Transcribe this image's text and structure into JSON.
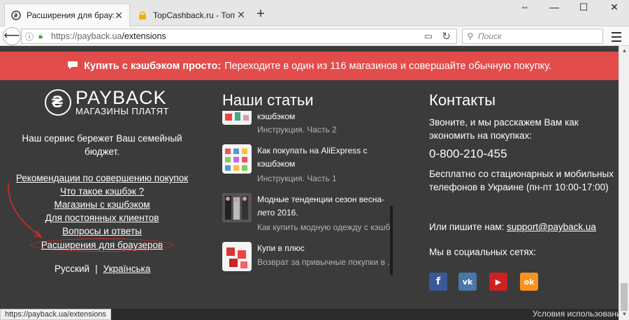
{
  "browser": {
    "tabs": [
      {
        "title": "Расширения для браузер",
        "favicon": "payback-favicon",
        "active": true
      },
      {
        "title": "TopCashback.ru - Топ лу",
        "favicon": "lock-favicon",
        "active": false
      }
    ],
    "new_tab": "+",
    "window": {
      "resize": "⇔",
      "minimize": "—",
      "maximize": "☐",
      "close": "✕"
    },
    "url_host": "https://payback.ua",
    "url_path": "/extensions",
    "search_placeholder": "Поиск",
    "status_url": "https://payback.ua/extensions"
  },
  "promo": {
    "bold": "Купить с кэшбэком просто:",
    "text": "Переходите в один из 116 магазинов и совершайте обычную покупку."
  },
  "col1": {
    "brand": "PAYBACK",
    "slogan": "МАГАЗИНЫ ПЛАТЯТ",
    "tagline": "Наш сервис бережет Ваш семейный бюджет.",
    "links": [
      "Рекомендации по совершению покупок",
      "Что такое кэшбэк ?",
      "Магазины с кэшбэком",
      "Для постоянных клиентов",
      "Вопросы и ответы",
      "Расширения для браузеров"
    ],
    "lang_ru": "Русский",
    "lang_sep": "|",
    "lang_uk": "Українська"
  },
  "col2": {
    "title": "Наши статьи",
    "articles": [
      {
        "title": "кэшбэком",
        "subtitle": "Инструкция. Часть 2"
      },
      {
        "title": "Как покупать на AliExpress с кэшбэком",
        "subtitle": "Инструкция. Часть 1"
      },
      {
        "title": "Модные тенденции сезон весна-лето 2016.",
        "subtitle": "Как купить модную одежду с кэшб..."
      },
      {
        "title": "Купи в плюс",
        "subtitle": "Возврат за привычные покупки в ..."
      }
    ]
  },
  "col3": {
    "title": "Контакты",
    "call_text": "Звоните, и мы расскажем Вам как экономить на покупках:",
    "phone": "0-800-210-455",
    "free_text": "Бесплатно со стационарных и мобильных телефонов в Украине (пн-пт 10:00-17:00)",
    "write_text": "Или пишите нам:",
    "email": "support@payback.ua",
    "social_text": "Мы в социальных сетях:",
    "social": [
      {
        "name": "facebook-icon",
        "glyph": "f",
        "color": "#3b5998"
      },
      {
        "name": "vk-icon",
        "glyph": "vk",
        "color": "#4a76a8"
      },
      {
        "name": "youtube-icon",
        "glyph": "▶",
        "color": "#cd201f"
      },
      {
        "name": "odnoklassniki-icon",
        "glyph": "ok",
        "color": "#f7931e"
      }
    ]
  },
  "terms": "Условия использования",
  "colors": {
    "promo": "#e24c4b",
    "footer": "#3b3b3b",
    "annotation": "#d62b2b"
  }
}
